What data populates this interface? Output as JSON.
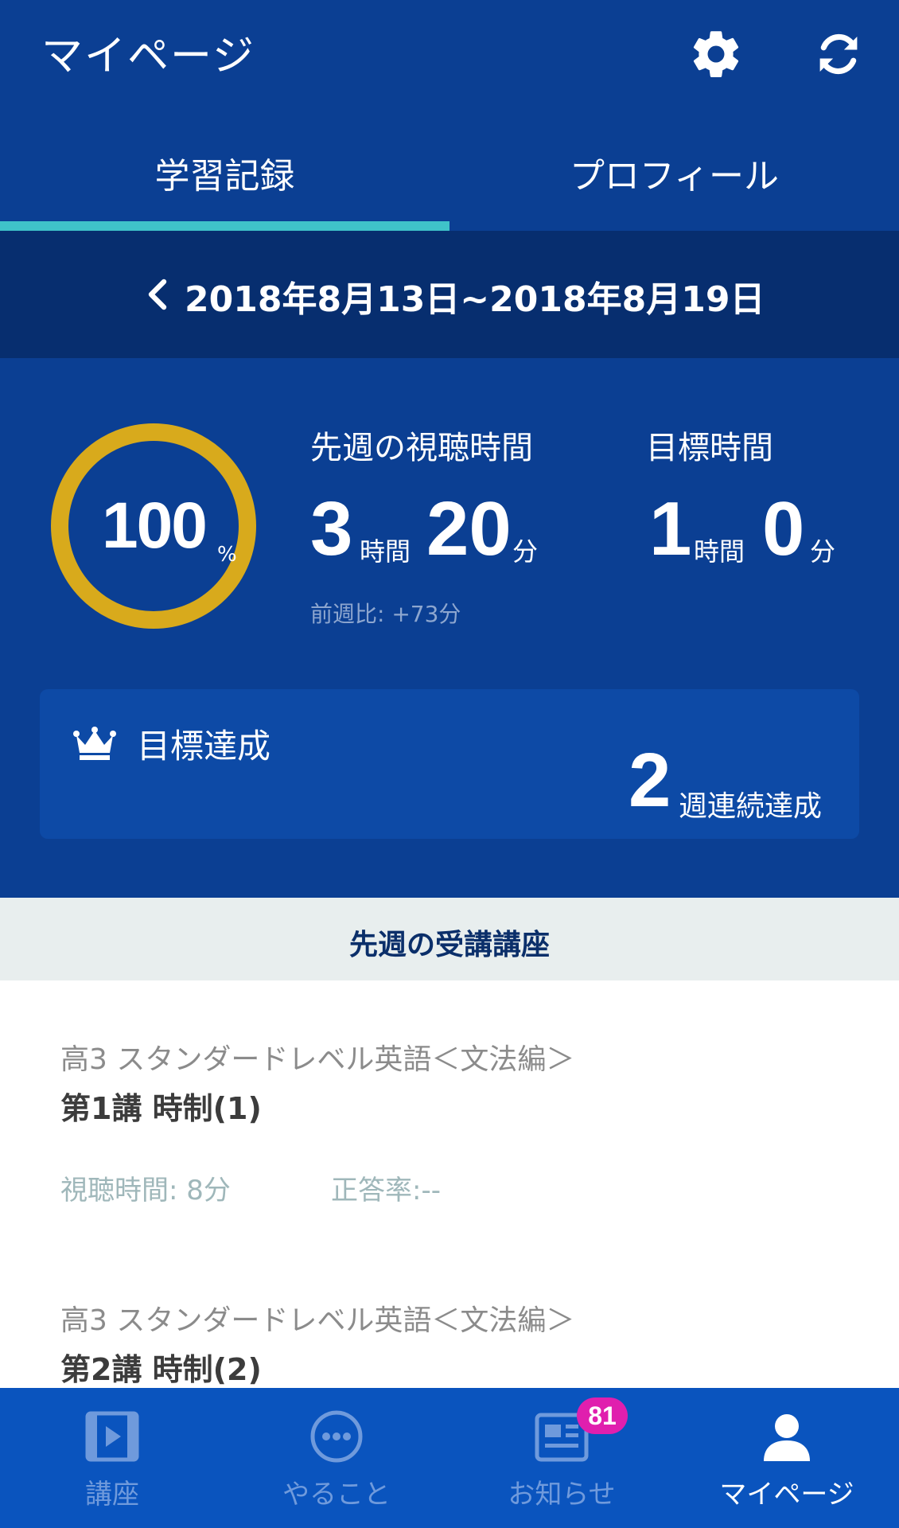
{
  "header": {
    "title": "マイページ",
    "icons": [
      "gear-icon",
      "refresh-icon"
    ]
  },
  "tabs": [
    {
      "label": "学習記録",
      "active": true
    },
    {
      "label": "プロフィール",
      "active": false
    }
  ],
  "week": {
    "range": "2018年8月13日~2018年8月19日"
  },
  "summary": {
    "achievement_percent": "100",
    "achievement_unit": "%",
    "watch_label": "先週の視聴時間",
    "watch_hours": "3",
    "hours_unit": "時間",
    "watch_minutes": "20",
    "minutes_unit": "分",
    "compare": "前週比: +73分",
    "target_label": "目標時間",
    "target_hours": "1",
    "target_minutes": "0"
  },
  "goal": {
    "title": "目標達成",
    "streak": "2",
    "streak_unit": "週連続達成"
  },
  "section": {
    "title": "先週の受講講座"
  },
  "courses": [
    {
      "series": "高3 スタンダードレベル英語＜文法編＞",
      "title": "第1講 時制(1)",
      "watch_time": "視聴時間: 8分",
      "accuracy": "正答率:--"
    },
    {
      "series": "高3 スタンダードレベル英語＜文法編＞",
      "title": "第2講 時制(2)"
    }
  ],
  "nav": {
    "items": [
      {
        "label": "講座",
        "icon": "video-icon"
      },
      {
        "label": "やること",
        "icon": "more-icon"
      },
      {
        "label": "お知らせ",
        "icon": "news-icon",
        "badge": "81"
      },
      {
        "label": "マイページ",
        "icon": "user-icon",
        "active": true
      }
    ]
  },
  "colors": {
    "primary": "#0b3f93",
    "week_bar": "#072e6f",
    "accent_tab": "#3fc3c9",
    "ring": "#d8aa1c",
    "nav": "#0a54be",
    "badge": "#e01fae"
  }
}
